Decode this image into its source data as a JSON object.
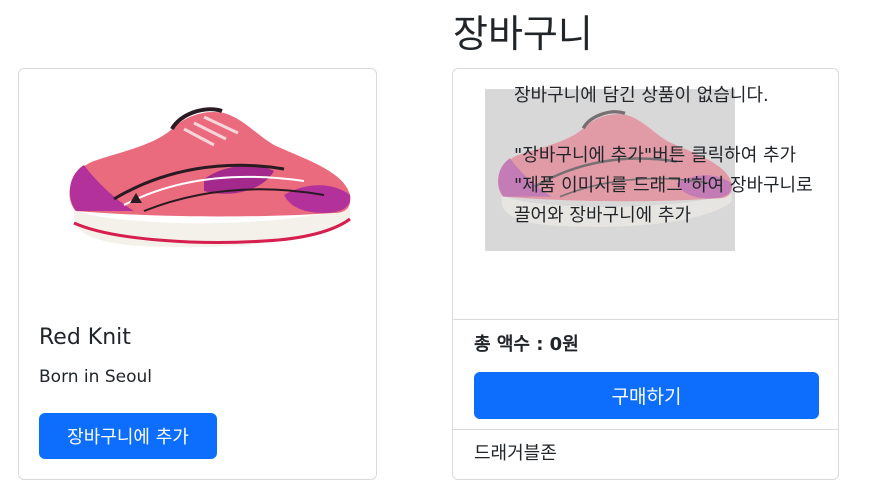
{
  "cart": {
    "heading": "장바구니",
    "empty_line1": "장바구니에 담긴 상품이 없습니다.",
    "empty_line2": "\"장바구니에 추가\"버튼 클릭하여 추가",
    "empty_line3": "\"제품 이미지를 드래그\"하여 장바구니로 끌어와 장바구니에 추가",
    "total_label": "총 액수 : 0원",
    "buy_label": "구매하기",
    "dropzone_label": "드래거블존"
  },
  "product": {
    "name": "Red Knit",
    "description": "Born in Seoul",
    "add_label": "장바구니에 추가",
    "image_icon": "pink-running-shoe"
  },
  "colors": {
    "primary": "#0d6efd",
    "border": "#d8dadd",
    "text": "#212529"
  }
}
